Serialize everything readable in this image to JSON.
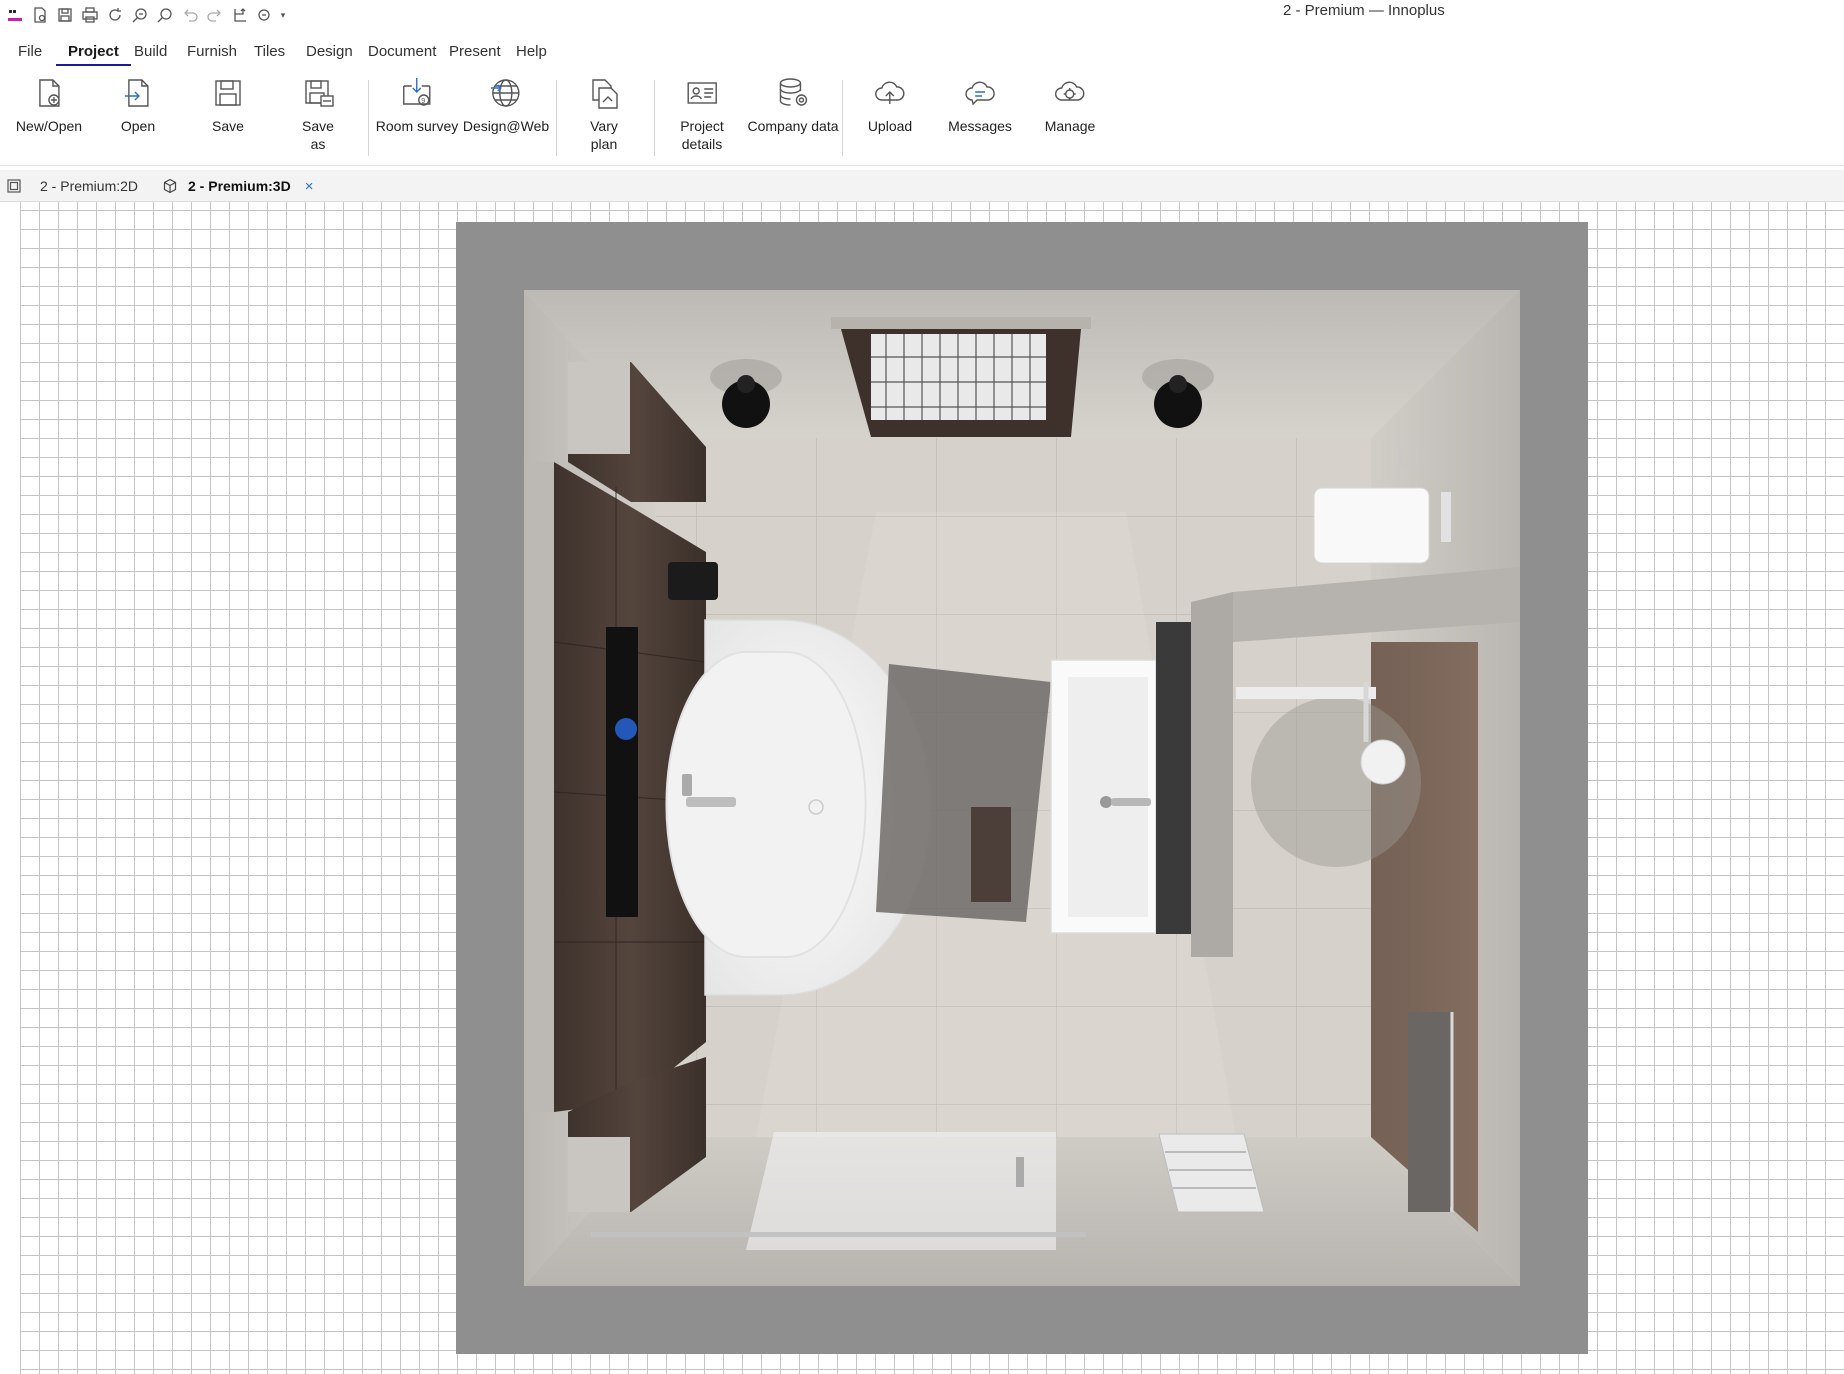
{
  "app": {
    "title": "2 - Premium — Innoplus"
  },
  "quick_access": [
    {
      "name": "new-document-icon"
    },
    {
      "name": "save-icon"
    },
    {
      "name": "print-icon"
    },
    {
      "name": "refresh-icon"
    },
    {
      "name": "zoom-icon"
    },
    {
      "name": "search-icon"
    },
    {
      "name": "undo-icon"
    },
    {
      "name": "redo-icon"
    },
    {
      "name": "transform-icon"
    },
    {
      "name": "options-dropdown-icon"
    }
  ],
  "menu": {
    "items": [
      "File",
      "Project",
      "Build",
      "Furnish",
      "Tiles",
      "Design",
      "Document",
      "Present",
      "Help"
    ],
    "active": "Project"
  },
  "ribbon": {
    "buttons": [
      {
        "label": "New/Open",
        "icon": "new-document-icon"
      },
      {
        "label": "Open",
        "icon": "open-file-icon"
      },
      {
        "label": "Save",
        "icon": "save-icon"
      },
      {
        "label": "Save\nas",
        "icon": "save-as-icon"
      },
      {
        "label": "Room survey",
        "icon": "room-survey-icon"
      },
      {
        "label": "Design@Web",
        "icon": "globe-icon"
      },
      {
        "label": "Vary\nplan",
        "icon": "vary-plan-icon"
      },
      {
        "label": "Project\ndetails",
        "icon": "project-details-icon"
      },
      {
        "label": "Company data",
        "icon": "database-gear-icon"
      },
      {
        "label": "Upload",
        "icon": "cloud-upload-icon"
      },
      {
        "label": "Messages",
        "icon": "messages-cloud-icon"
      },
      {
        "label": "Manage",
        "icon": "manage-cloud-icon"
      }
    ]
  },
  "tabs": [
    {
      "label": "2 - Premium:2D",
      "icon": "plan-2d-icon",
      "active": false
    },
    {
      "label": "2 - Premium:3D",
      "icon": "cube-3d-icon",
      "active": true,
      "close": "×"
    }
  ],
  "scene": {
    "view": "3D top-down bathroom render",
    "colors": {
      "outer_wall": "#8f8f8f",
      "inner_wall": "#c9c6c1",
      "floor": "#d8d3cc",
      "cabinet": "#4a3a33",
      "accent_blue": "#2458b8"
    }
  }
}
